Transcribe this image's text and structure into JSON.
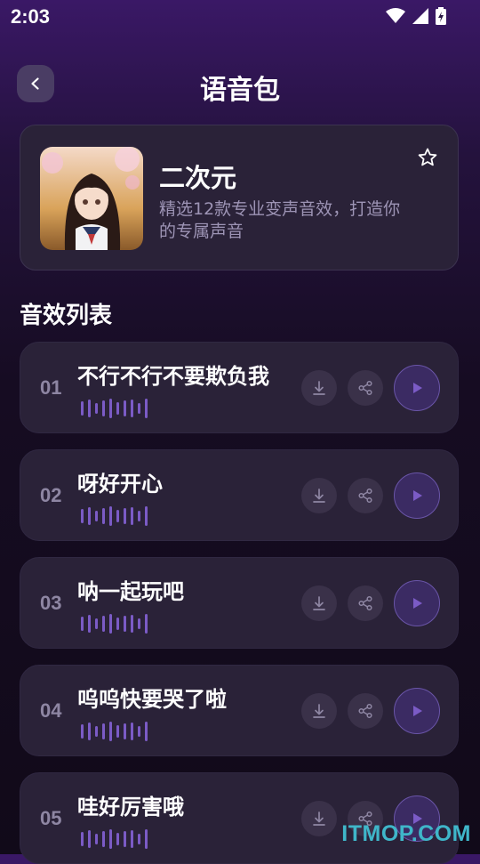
{
  "status_bar": {
    "time": "2:03"
  },
  "header": {
    "title": "语音包"
  },
  "pack": {
    "name": "二次元",
    "description": "精选12款专业变声音效，打造你的专属声音"
  },
  "section": {
    "title": "音效列表"
  },
  "sounds": [
    {
      "number": "01",
      "title": "不行不行不要欺负我"
    },
    {
      "number": "02",
      "title": "呀好开心"
    },
    {
      "number": "03",
      "title": "呐一起玩吧"
    },
    {
      "number": "04",
      "title": "呜呜快要哭了啦"
    },
    {
      "number": "05",
      "title": "哇好厉害哦"
    }
  ],
  "watermark": "ITMOP.COM",
  "colors": {
    "accent": "#7b5bc6",
    "card": "#2a2238",
    "background": "#110a19"
  }
}
